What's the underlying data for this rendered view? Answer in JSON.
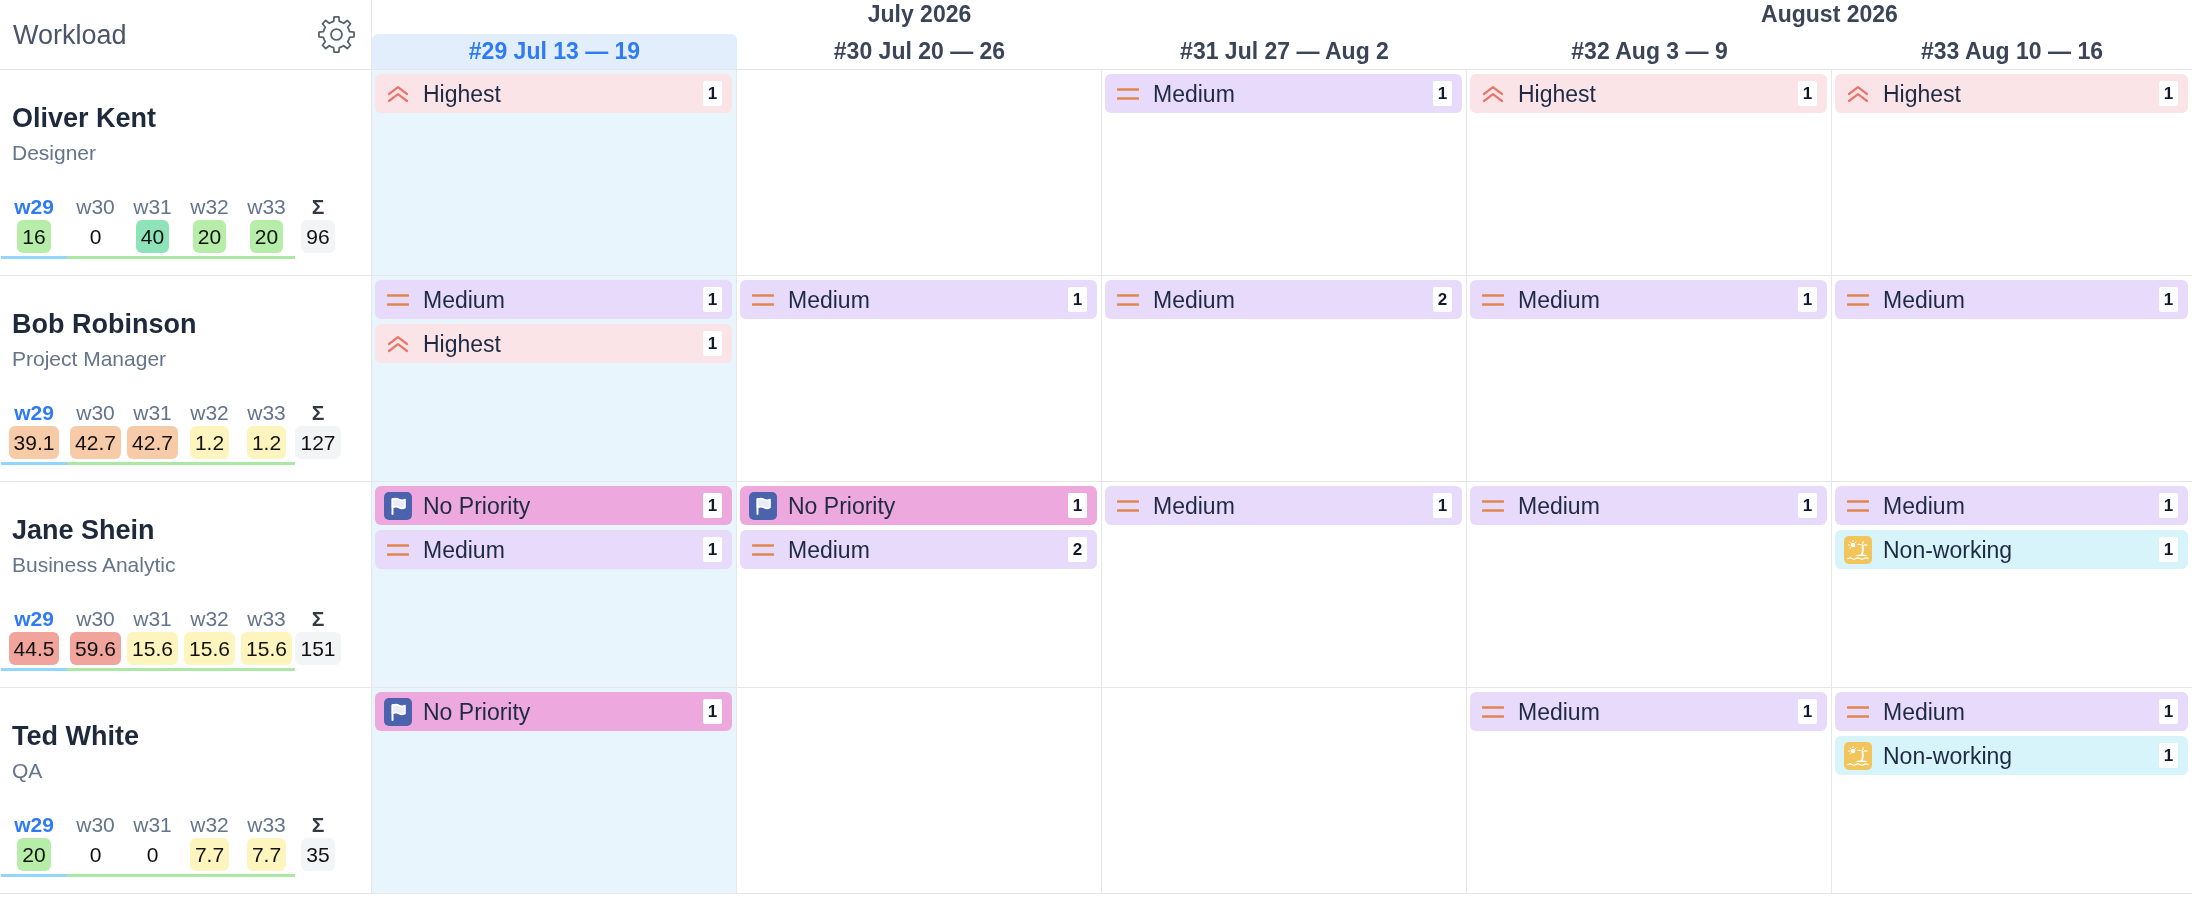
{
  "title": "Workload",
  "header": {
    "months": [
      {
        "label": "July 2026",
        "weeks": [
          {
            "label": "#29 Jul 13 — 19",
            "current": true
          },
          {
            "label": "#30 Jul 20 — 26",
            "current": false
          },
          {
            "label": "#31 Jul 27 — Aug 2",
            "current": false
          }
        ]
      },
      {
        "label": "August 2026",
        "weeks": [
          {
            "label": "#32 Aug 3 — 9",
            "current": false
          },
          {
            "label": "#33 Aug 10 — 16",
            "current": false
          }
        ]
      }
    ]
  },
  "people": [
    {
      "name": "Oliver Kent",
      "role": "Designer",
      "stats": [
        {
          "label": "w29",
          "value": "16",
          "current": true,
          "color": "#b6eda8"
        },
        {
          "label": "w30",
          "value": "0",
          "current": false
        },
        {
          "label": "w31",
          "value": "40",
          "current": false,
          "color": "#8ee3b9"
        },
        {
          "label": "w32",
          "value": "20",
          "current": false,
          "color": "#b6eda8"
        },
        {
          "label": "w33",
          "value": "20",
          "current": false,
          "color": "#b6eda8"
        }
      ],
      "total": {
        "label": "Σ",
        "value": "96"
      },
      "tasks_by_week": {
        "week_1": [
          {
            "kind": "highest",
            "label": "Highest",
            "count": "1"
          }
        ],
        "week_3": [
          {
            "kind": "medium",
            "label": "Medium",
            "count": "1"
          }
        ],
        "week_4": [
          {
            "kind": "highest",
            "label": "Highest",
            "count": "1"
          }
        ],
        "week_5": [
          {
            "kind": "highest",
            "label": "Highest",
            "count": "1"
          }
        ]
      }
    },
    {
      "name": "Bob Robinson",
      "role": "Project Manager",
      "stats": [
        {
          "label": "w29",
          "value": "39.1",
          "current": true,
          "color": "#f7cba7"
        },
        {
          "label": "w30",
          "value": "42.7",
          "current": false,
          "color": "#f7cba7"
        },
        {
          "label": "w31",
          "value": "42.7",
          "current": false,
          "color": "#f7cba7"
        },
        {
          "label": "w32",
          "value": "1.2",
          "current": false,
          "color": "#fdf5bd"
        },
        {
          "label": "w33",
          "value": "1.2",
          "current": false,
          "color": "#fdf5bd"
        }
      ],
      "total": {
        "label": "Σ",
        "value": "127"
      },
      "tasks_by_week": {
        "week_1": [
          {
            "kind": "medium",
            "label": "Medium",
            "count": "1"
          },
          {
            "kind": "highest",
            "label": "Highest",
            "count": "1"
          }
        ],
        "week_2": [
          {
            "kind": "medium",
            "label": "Medium",
            "count": "1"
          }
        ],
        "week_3": [
          {
            "kind": "medium",
            "label": "Medium",
            "count": "2"
          }
        ],
        "week_4": [
          {
            "kind": "medium",
            "label": "Medium",
            "count": "1"
          }
        ],
        "week_5": [
          {
            "kind": "medium",
            "label": "Medium",
            "count": "1"
          }
        ]
      }
    },
    {
      "name": "Jane Shein",
      "role": "Business Analytic",
      "stats": [
        {
          "label": "w29",
          "value": "44.5",
          "current": true,
          "color": "#f0a49c"
        },
        {
          "label": "w30",
          "value": "59.6",
          "current": false,
          "color": "#f0a49c"
        },
        {
          "label": "w31",
          "value": "15.6",
          "current": false,
          "color": "#fdf5bd"
        },
        {
          "label": "w32",
          "value": "15.6",
          "current": false,
          "color": "#fdf5bd"
        },
        {
          "label": "w33",
          "value": "15.6",
          "current": false,
          "color": "#fdf5bd"
        }
      ],
      "total": {
        "label": "Σ",
        "value": "151"
      },
      "tasks_by_week": {
        "week_1": [
          {
            "kind": "no-priority",
            "label": "No Priority",
            "count": "1"
          },
          {
            "kind": "medium",
            "label": "Medium",
            "count": "1"
          }
        ],
        "week_2": [
          {
            "kind": "no-priority",
            "label": "No Priority",
            "count": "1"
          },
          {
            "kind": "medium",
            "label": "Medium",
            "count": "2"
          }
        ],
        "week_3": [
          {
            "kind": "medium",
            "label": "Medium",
            "count": "1"
          }
        ],
        "week_4": [
          {
            "kind": "medium",
            "label": "Medium",
            "count": "1"
          }
        ],
        "week_5": [
          {
            "kind": "medium",
            "label": "Medium",
            "count": "1"
          },
          {
            "kind": "non-working",
            "label": "Non-working",
            "count": "1"
          }
        ]
      }
    },
    {
      "name": "Ted White",
      "role": "QA",
      "stats": [
        {
          "label": "w29",
          "value": "20",
          "current": true,
          "color": "#b6eda8"
        },
        {
          "label": "w30",
          "value": "0",
          "current": false
        },
        {
          "label": "w31",
          "value": "0",
          "current": false
        },
        {
          "label": "w32",
          "value": "7.7",
          "current": false,
          "color": "#fdf5bd"
        },
        {
          "label": "w33",
          "value": "7.7",
          "current": false,
          "color": "#fdf5bd"
        }
      ],
      "total": {
        "label": "Σ",
        "value": "35"
      },
      "tasks_by_week": {
        "week_1": [
          {
            "kind": "no-priority",
            "label": "No Priority",
            "count": "1"
          }
        ],
        "week_4": [
          {
            "kind": "medium",
            "label": "Medium",
            "count": "1"
          }
        ],
        "week_5": [
          {
            "kind": "medium",
            "label": "Medium",
            "count": "1"
          },
          {
            "kind": "non-working",
            "label": "Non-working",
            "count": "1"
          }
        ]
      }
    }
  ]
}
